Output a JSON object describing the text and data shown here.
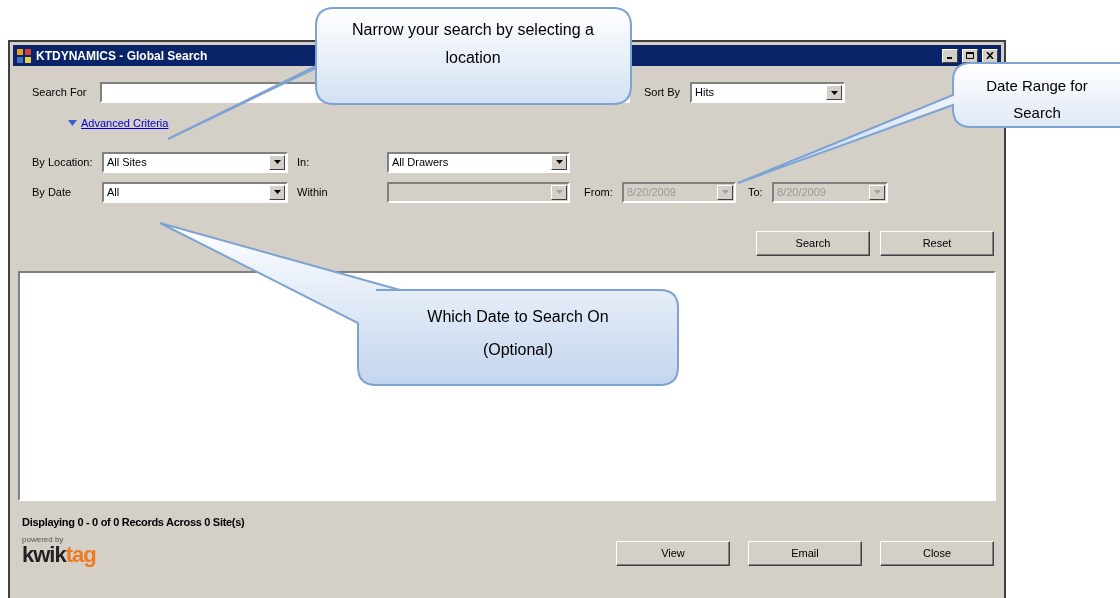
{
  "window": {
    "title": "KTDYNAMICS - Global Search"
  },
  "search": {
    "label": "Search For",
    "sort_label": "Sort By",
    "sort_value": "Hits"
  },
  "advanced": {
    "label": "Advanced Criteria",
    "expanded": true
  },
  "criteria": [
    {
      "label": "By Location:",
      "value": "All Sites",
      "disabled": false,
      "label2": "In:",
      "value2": "All Drawers",
      "disabled2": false
    },
    {
      "label": "By Date",
      "value": "All",
      "disabled": false,
      "label2": "Within",
      "disabled2": true
    }
  ],
  "date_range": {
    "from_label": "From:",
    "from": "8/20/2009",
    "to_label": "To:",
    "to": "8/20/2009",
    "disabled": true
  },
  "action_buttons": [
    "Search",
    "Reset"
  ],
  "status": "Displaying 0 - 0 of 0 Records Across 0 Site(s)",
  "logo": {
    "tagline": "powered by",
    "word1": "kwik",
    "word2": "tag"
  },
  "footer_buttons": [
    "View",
    "Email",
    "Close"
  ],
  "callouts": [
    {
      "text": "Narrow your search by selecting a location"
    },
    {
      "text": "Date Range for Search"
    },
    {
      "text": "Which Date to Search On (Optional)"
    }
  ]
}
